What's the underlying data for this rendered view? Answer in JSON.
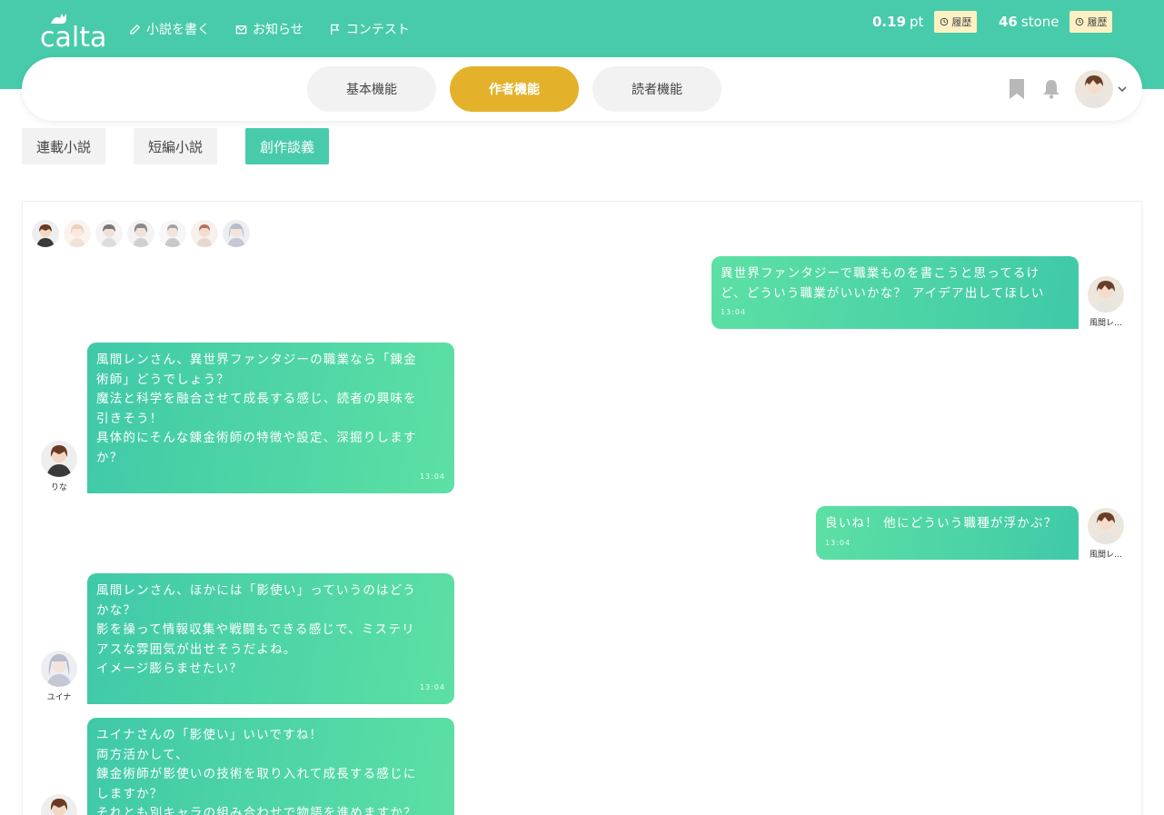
{
  "header": {
    "logo_text": "calta",
    "nav": [
      {
        "label": "小説を書く",
        "icon": "pencil-icon"
      },
      {
        "label": "お知らせ",
        "icon": "envelope-icon"
      },
      {
        "label": "コンテスト",
        "icon": "flag-icon"
      }
    ],
    "points": {
      "value": "0.19",
      "unit": "pt",
      "history_label": "履歴"
    },
    "stones": {
      "value": "46",
      "unit": "stone",
      "history_label": "履歴"
    }
  },
  "mode_tabs": [
    {
      "label": "基本機能",
      "active": false
    },
    {
      "label": "作者機能",
      "active": true
    },
    {
      "label": "読者機能",
      "active": false
    }
  ],
  "sub_tabs": [
    {
      "label": "連載小説",
      "active": false
    },
    {
      "label": "短編小説",
      "active": false
    },
    {
      "label": "創作談義",
      "active": true
    }
  ],
  "chat": {
    "messages": [
      {
        "side": "right",
        "speaker": "風間レ…",
        "time": "13:04",
        "text": "異世界ファンタジーで職業ものを書こうと思ってるけ\nど、どういう職業がいいかな？ アイデア出してほしい"
      },
      {
        "side": "left",
        "speaker": "りな",
        "time": "13:04",
        "text": "風間レンさん、異世界ファンタジーの職業なら「錬金\n術師」どうでしょう？\n魔法と科学を融合させて成長する感じ、読者の興味を\n引きそう！\n具体的にそんな錬金術師の特徴や設定、深掘りします\nか？"
      },
      {
        "side": "right",
        "speaker": "風間レ…",
        "time": "13:04",
        "text": "良いね！ 他にどういう職種が浮かぶ？"
      },
      {
        "side": "left",
        "speaker": "ユイナ",
        "time": "13:04",
        "text": "風間レンさん、ほかには「影使い」っていうのはどう\nかな？\n影を操って情報収集や戦闘もできる感じで、ミステリ\nアスな雰囲気が出せそうだよね。\nイメージ膨らませたい？"
      },
      {
        "side": "left",
        "speaker": "",
        "time": "",
        "text": "ユイナさんの「影使い」いいですね！\n両方活かして、\n錬金術師が影使いの技術を取り入れて成長する感じに\nしますか？\nそれとも別キャラの組み合わせで物語を進めますか？"
      }
    ]
  },
  "colors": {
    "brand": "#48cbaa",
    "active_mode": "#e3b22a",
    "history_bg": "#fdf1c4"
  }
}
